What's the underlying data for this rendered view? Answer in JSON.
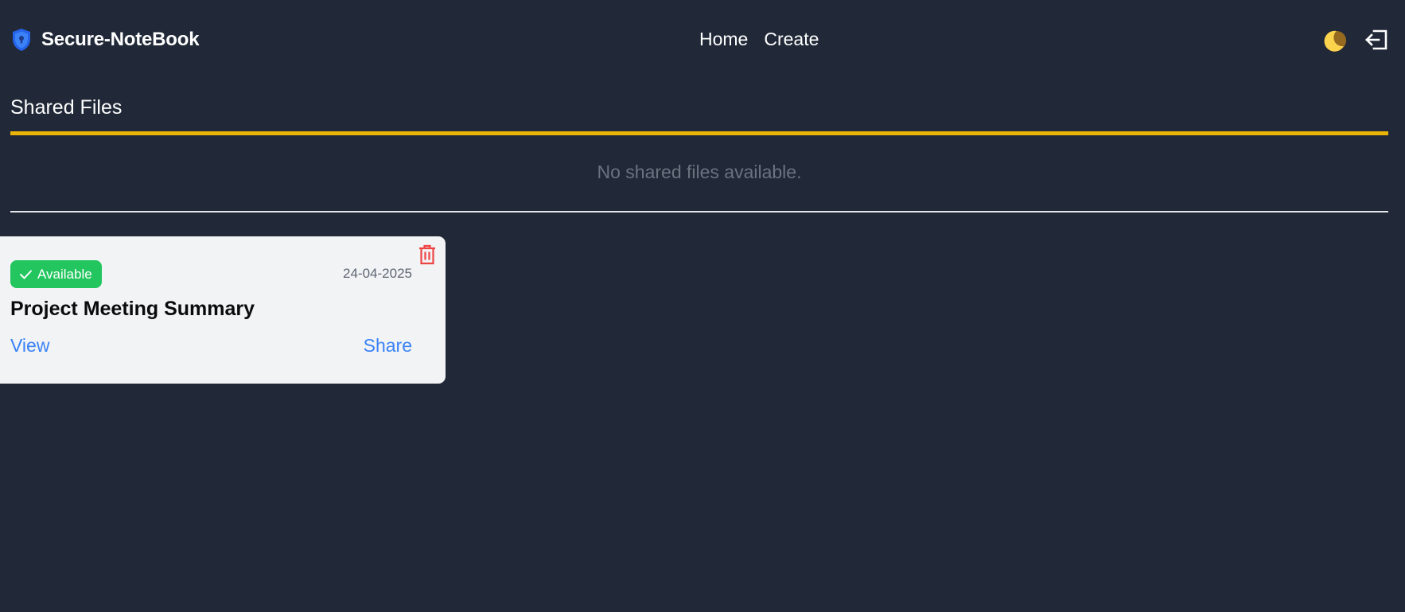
{
  "app": {
    "name": "Secure-NoteBook",
    "logo_icon": "shield-lock-icon",
    "accent_color": "#2563eb"
  },
  "nav": {
    "links": [
      "Home",
      "Create"
    ]
  },
  "header_actions": {
    "theme_icon": "moon-icon",
    "logout_icon": "logout-icon"
  },
  "shared_section": {
    "title": "Shared Files",
    "underline_color": "#eab308",
    "empty_message": "No shared files available."
  },
  "notes": [
    {
      "status": "Available",
      "status_icon": "check-icon",
      "status_color": "#22c55e",
      "date": "24-04-2025",
      "title": "Project Meeting Summary",
      "view_label": "View",
      "share_label": "Share",
      "delete_icon": "trash-icon",
      "delete_color": "#ef4444"
    }
  ],
  "colors": {
    "background": "#212938",
    "link": "#3b82f6"
  }
}
